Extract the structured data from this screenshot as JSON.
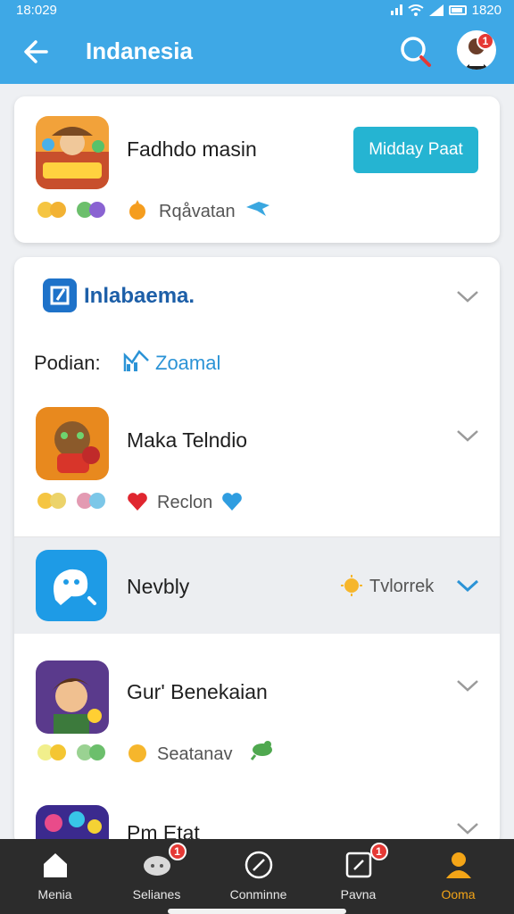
{
  "status": {
    "time": "18:029",
    "right_time": "1820"
  },
  "appbar": {
    "title": "Indanesia"
  },
  "featured": {
    "app_name": "Fadhdo masin",
    "action_label": "Midday Paat",
    "meta_text": "Rqåvatan"
  },
  "section": {
    "title": "Inlabaema.",
    "filter_label": "Podian:",
    "filter_value": "Zoamal"
  },
  "apps": [
    {
      "name": "Maka Telndio",
      "meta_text": "Reclon"
    },
    {
      "name": "Nevbly",
      "meta_text": "Tvlorrek"
    },
    {
      "name": "Gur' Benekaian",
      "meta_text": "Seatanav"
    },
    {
      "name": "Pm Etat"
    }
  ],
  "nav": {
    "items": [
      {
        "label": "Menia"
      },
      {
        "label": "Selianes",
        "badge": "1"
      },
      {
        "label": "Conminne"
      },
      {
        "label": "Pavna",
        "badge": "1"
      },
      {
        "label": "Ooma"
      }
    ]
  },
  "account": {
    "badge": "1"
  },
  "colors": {
    "primary": "#3ea8e6",
    "accent_button": "#25b4d2",
    "nav_bg": "#2c2c2c",
    "nav_active": "#f4a517",
    "badge": "#e53935"
  },
  "icons": [
    "back-arrow-icon",
    "search-icon",
    "sun-icon",
    "heart-icon",
    "chevron-down-icon",
    "home-icon",
    "chat-icon",
    "compass-icon",
    "bookmark-icon",
    "person-icon"
  ]
}
